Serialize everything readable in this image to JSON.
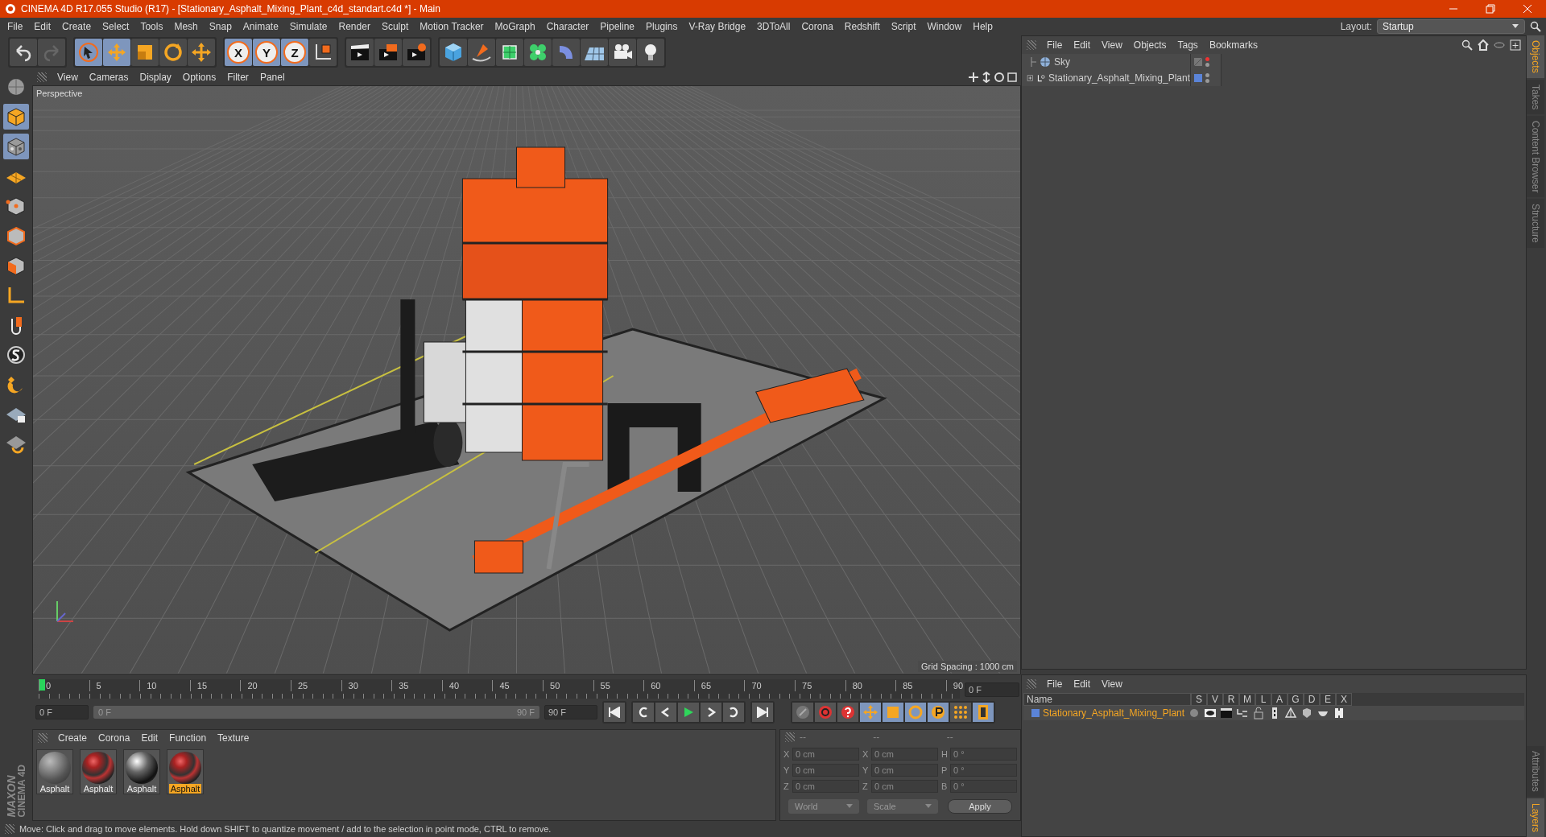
{
  "window": {
    "title": "CINEMA 4D R17.055 Studio (R17) - [Stationary_Asphalt_Mixing_Plant_c4d_standart.c4d *] - Main"
  },
  "menu": [
    "File",
    "Edit",
    "Create",
    "Select",
    "Tools",
    "Mesh",
    "Snap",
    "Animate",
    "Simulate",
    "Render",
    "Sculpt",
    "Motion Tracker",
    "MoGraph",
    "Character",
    "Pipeline",
    "Plugins",
    "V-Ray Bridge",
    "3DToAll",
    "Corona",
    "Redshift",
    "Script",
    "Window",
    "Help"
  ],
  "layout": {
    "label": "Layout:",
    "value": "Startup"
  },
  "toolbar": [
    {
      "kind": "undo",
      "selected": false
    },
    {
      "kind": "redo",
      "selected": false
    },
    {
      "kind": "select",
      "selected": true
    },
    {
      "kind": "move",
      "selected": true
    },
    {
      "kind": "scale",
      "selected": false
    },
    {
      "kind": "rotate",
      "selected": false
    },
    {
      "kind": "transform",
      "selected": false
    },
    {
      "kind": "axis",
      "label": "X",
      "selected": true
    },
    {
      "kind": "axis",
      "label": "Y",
      "selected": true
    },
    {
      "kind": "axis",
      "label": "Z",
      "selected": true
    },
    {
      "kind": "coord",
      "selected": false
    },
    {
      "kind": "render-view",
      "selected": false
    },
    {
      "kind": "render-picture",
      "selected": false
    },
    {
      "kind": "render-settings",
      "selected": false
    },
    {
      "kind": "cube",
      "selected": false
    },
    {
      "kind": "pen",
      "selected": false
    },
    {
      "kind": "subdivide",
      "selected": false
    },
    {
      "kind": "cloner",
      "selected": false
    },
    {
      "kind": "deformer",
      "selected": false
    },
    {
      "kind": "floor",
      "selected": false
    },
    {
      "kind": "camera",
      "selected": false
    },
    {
      "kind": "light",
      "selected": false
    }
  ],
  "left_tools": [
    {
      "kind": "sphere",
      "selected": false
    },
    {
      "kind": "model",
      "selected": true
    },
    {
      "kind": "texture",
      "selected": true
    },
    {
      "kind": "workplane",
      "selected": false
    },
    {
      "kind": "points",
      "selected": false
    },
    {
      "kind": "edges",
      "selected": false
    },
    {
      "kind": "polygons",
      "selected": false
    },
    {
      "kind": "axis",
      "selected": false
    },
    {
      "kind": "tweak",
      "selected": false
    },
    {
      "kind": "solo",
      "selected": false
    },
    {
      "kind": "magnet",
      "selected": false
    },
    {
      "kind": "grid-lock",
      "selected": false
    },
    {
      "kind": "grid-snap",
      "selected": false
    }
  ],
  "brand": [
    "MAXON",
    "CINEMA 4D"
  ],
  "viewport": {
    "menu": [
      "View",
      "Cameras",
      "Display",
      "Options",
      "Filter",
      "Panel"
    ],
    "camera": "Perspective",
    "grid_spacing": "Grid Spacing : 1000 cm"
  },
  "timeline": {
    "ticks": [
      "0",
      "5",
      "10",
      "15",
      "20",
      "25",
      "30",
      "35",
      "40",
      "45",
      "50",
      "55",
      "60",
      "65",
      "70",
      "75",
      "80",
      "85",
      "90"
    ],
    "level": 0,
    "current": "0 F"
  },
  "transport": {
    "start": "0 F",
    "range_start": "0 F",
    "range_end": "90 F",
    "end": "90 F",
    "level": 1
  },
  "key_tools": [
    {
      "kind": "keyframe",
      "selected": false
    },
    {
      "kind": "autokey",
      "selected": false
    },
    {
      "kind": "help-key",
      "selected": false
    },
    {
      "kind": "move",
      "selected": true
    },
    {
      "kind": "scale",
      "selected": true
    },
    {
      "kind": "rotate",
      "selected": true
    },
    {
      "kind": "param",
      "selected": true
    },
    {
      "kind": "points",
      "selected": false
    },
    {
      "kind": "film",
      "selected": true
    }
  ],
  "materials": {
    "menu": [
      "Create",
      "Corona",
      "Edit",
      "Function",
      "Texture"
    ],
    "items": [
      {
        "name": "Asphalt",
        "kind": "grey",
        "selected": false
      },
      {
        "name": "Asphalt",
        "kind": "textured",
        "selected": false
      },
      {
        "name": "Asphalt",
        "kind": "chrome",
        "selected": false
      },
      {
        "name": "Asphalt",
        "kind": "textured",
        "selected": true
      }
    ]
  },
  "coordinates": {
    "headers": [
      "--",
      "--",
      "--"
    ],
    "rows": [
      [
        {
          "axis": "X",
          "value": "0 cm"
        },
        {
          "axis": "X",
          "value": "0 cm"
        },
        {
          "axis": "H",
          "value": "0 °"
        }
      ],
      [
        {
          "axis": "Y",
          "value": "0 cm"
        },
        {
          "axis": "Y",
          "value": "0 cm"
        },
        {
          "axis": "P",
          "value": "0 °"
        }
      ],
      [
        {
          "axis": "Z",
          "value": "0 cm"
        },
        {
          "axis": "Z",
          "value": "0 cm"
        },
        {
          "axis": "B",
          "value": "0 °"
        }
      ]
    ],
    "mode": "World",
    "scale": "Scale",
    "apply": "Apply"
  },
  "status_bar": "Move: Click and drag to move elements. Hold down SHIFT to quantize movement / add to the selection in point mode, CTRL to remove.",
  "objects": {
    "menu": [
      "File",
      "Edit",
      "View",
      "Objects",
      "Tags",
      "Bookmarks"
    ],
    "items": [
      {
        "name": "Sky",
        "kind": "sky",
        "expanded": true,
        "editor_visible": false
      },
      {
        "name": "Stationary_Asphalt_Mixing_Plant",
        "kind": "null",
        "expanded": false,
        "editor_visible": true,
        "color": "#5b84d8"
      }
    ]
  },
  "layers": {
    "menu": [
      "File",
      "Edit",
      "View"
    ],
    "columns": [
      "Name",
      "S",
      "V",
      "R",
      "M",
      "L",
      "A",
      "G",
      "D",
      "E",
      "X"
    ],
    "rows": [
      {
        "name": "Stationary_Asphalt_Mixing_Plant",
        "color": "#5b84d8"
      }
    ]
  },
  "side_tabs": [
    {
      "label": "Objects",
      "selected": true
    },
    {
      "label": "Takes",
      "selected": false
    },
    {
      "label": "Content Browser",
      "selected": false
    },
    {
      "label": "Structure",
      "selected": false
    }
  ],
  "bottom_side_tabs": [
    {
      "label": "Attributes",
      "selected": false
    },
    {
      "label": "Layers",
      "selected": true
    }
  ]
}
